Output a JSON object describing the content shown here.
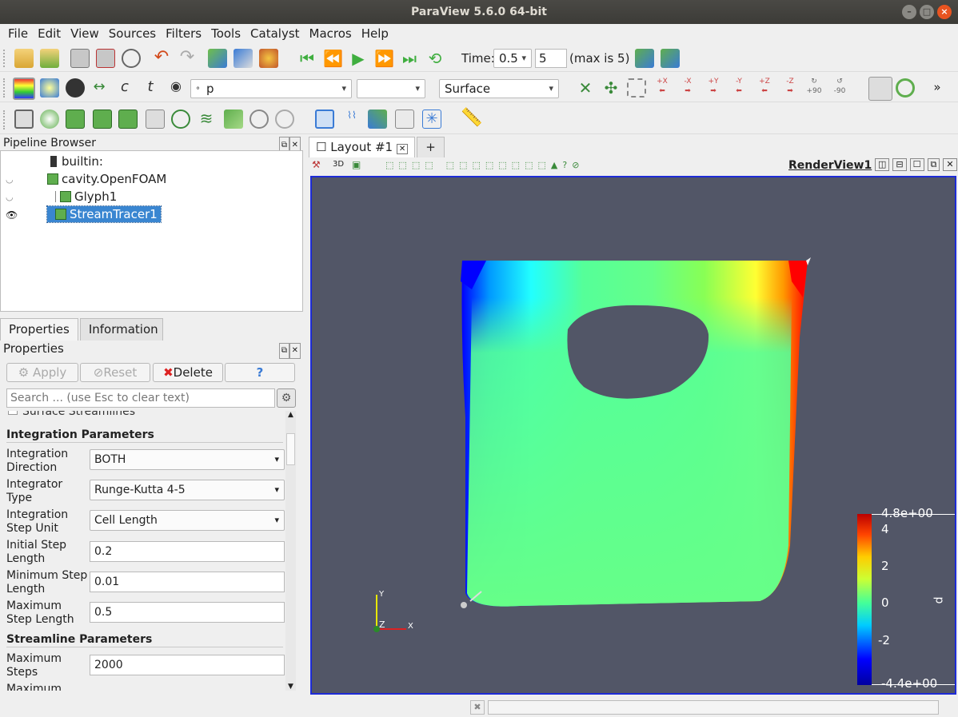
{
  "window": {
    "title": "ParaView 5.6.0 64-bit"
  },
  "menu": [
    "File",
    "Edit",
    "View",
    "Sources",
    "Filters",
    "Tools",
    "Catalyst",
    "Macros",
    "Help"
  ],
  "time": {
    "label": "Time:",
    "value": "0.5",
    "step": "5",
    "max": "(max is 5)"
  },
  "toolbar2": {
    "array": "p",
    "component": "",
    "representation": "Surface",
    "ps90": "+90",
    "ms90": "-90",
    "cam": {
      "px": "+X",
      "mx": "-X",
      "py": "+Y",
      "my": "-Y",
      "pz": "+Z",
      "mz": "-Z"
    },
    "more": "»"
  },
  "pipeline": {
    "title": "Pipeline Browser",
    "items": [
      "builtin:",
      "cavity.OpenFOAM",
      "Glyph1",
      "StreamTracer1"
    ]
  },
  "tabs": [
    "Properties",
    "Information"
  ],
  "properties": {
    "title": "Properties",
    "apply": "Apply",
    "reset": "Reset",
    "delete": "Delete",
    "help": "?",
    "search_placeholder": "Search ... (use Esc to clear text)",
    "partial_top": "Surface Streamlines",
    "integration_section": "Integration Parameters",
    "rows": [
      {
        "label": "Integration Direction",
        "value": "BOTH",
        "type": "combo"
      },
      {
        "label": "Integrator Type",
        "value": "Runge-Kutta 4-5",
        "type": "combo"
      },
      {
        "label": "Integration Step Unit",
        "value": "Cell Length",
        "type": "combo"
      },
      {
        "label": "Initial Step Length",
        "value": "0.2",
        "type": "field"
      },
      {
        "label": "Minimum Step Length",
        "value": "0.01",
        "type": "field"
      },
      {
        "label": "Maximum Step Length",
        "value": "0.5",
        "type": "field"
      }
    ],
    "streamline_section": "Streamline Parameters",
    "rows2": [
      {
        "label": "Maximum Steps",
        "value": "2000",
        "type": "field"
      }
    ],
    "partial_bottom": "Maximum"
  },
  "layout": {
    "tab": "Layout #1",
    "add": "+",
    "view_name": "RenderView1",
    "mode": "3D"
  },
  "colorbar": {
    "max": "4.8e+00",
    "min": "-4.4e+00",
    "ticks": [
      "4",
      "2",
      "0",
      "-2"
    ],
    "title": "p"
  },
  "axes": {
    "x": "X",
    "y": "Y",
    "z": "Z"
  },
  "colors": {
    "selection": "#3a86d1",
    "render_bg": "#525667",
    "border": "#1d2bd6"
  }
}
